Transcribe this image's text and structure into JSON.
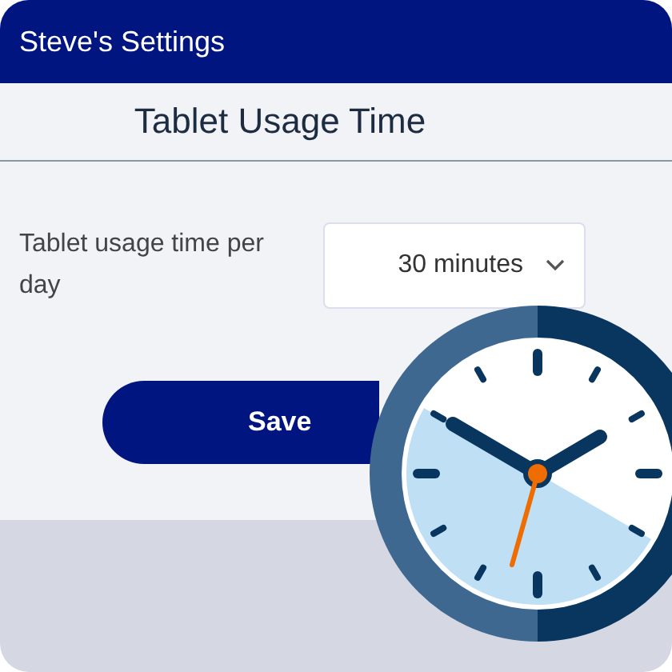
{
  "window": {
    "title": "Steve's Settings"
  },
  "heading": "Tablet Usage Time",
  "setting": {
    "label": "Tablet usage time per day",
    "value": "30 minutes"
  },
  "buttons": [
    "Save"
  ]
}
